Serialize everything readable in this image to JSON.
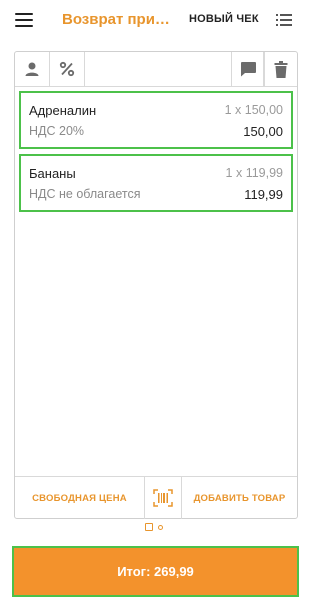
{
  "header": {
    "title": "Возврат при…",
    "new_check_label": "НОВЫЙ ЧЕК",
    "menu_icon": "hamburger-menu-icon",
    "list_icon": "list-icon"
  },
  "toolbar": {
    "icons": [
      "user-icon",
      "percent-icon",
      "comment-icon",
      "trash-icon"
    ]
  },
  "items": [
    {
      "name": "Адреналин",
      "quantity": "1 x 150,00",
      "tax": "НДС 20%",
      "total": "150,00"
    },
    {
      "name": "Бананы",
      "quantity": "1 x 119,99",
      "tax": "НДС не облагается",
      "total": "119,99"
    }
  ],
  "actions": {
    "free_price_label": "СВОБОДНАЯ ЦЕНА",
    "barcode_icon": "barcode-scan-icon",
    "add_item_label": "ДОБАВИТЬ ТОВАР"
  },
  "pager": {
    "page": 1,
    "total": 2
  },
  "total_button": {
    "label": "Итог: 269,99"
  },
  "colors": {
    "accent": "#e8952d",
    "highlight": "#4cc14a",
    "button": "#f3922c"
  }
}
